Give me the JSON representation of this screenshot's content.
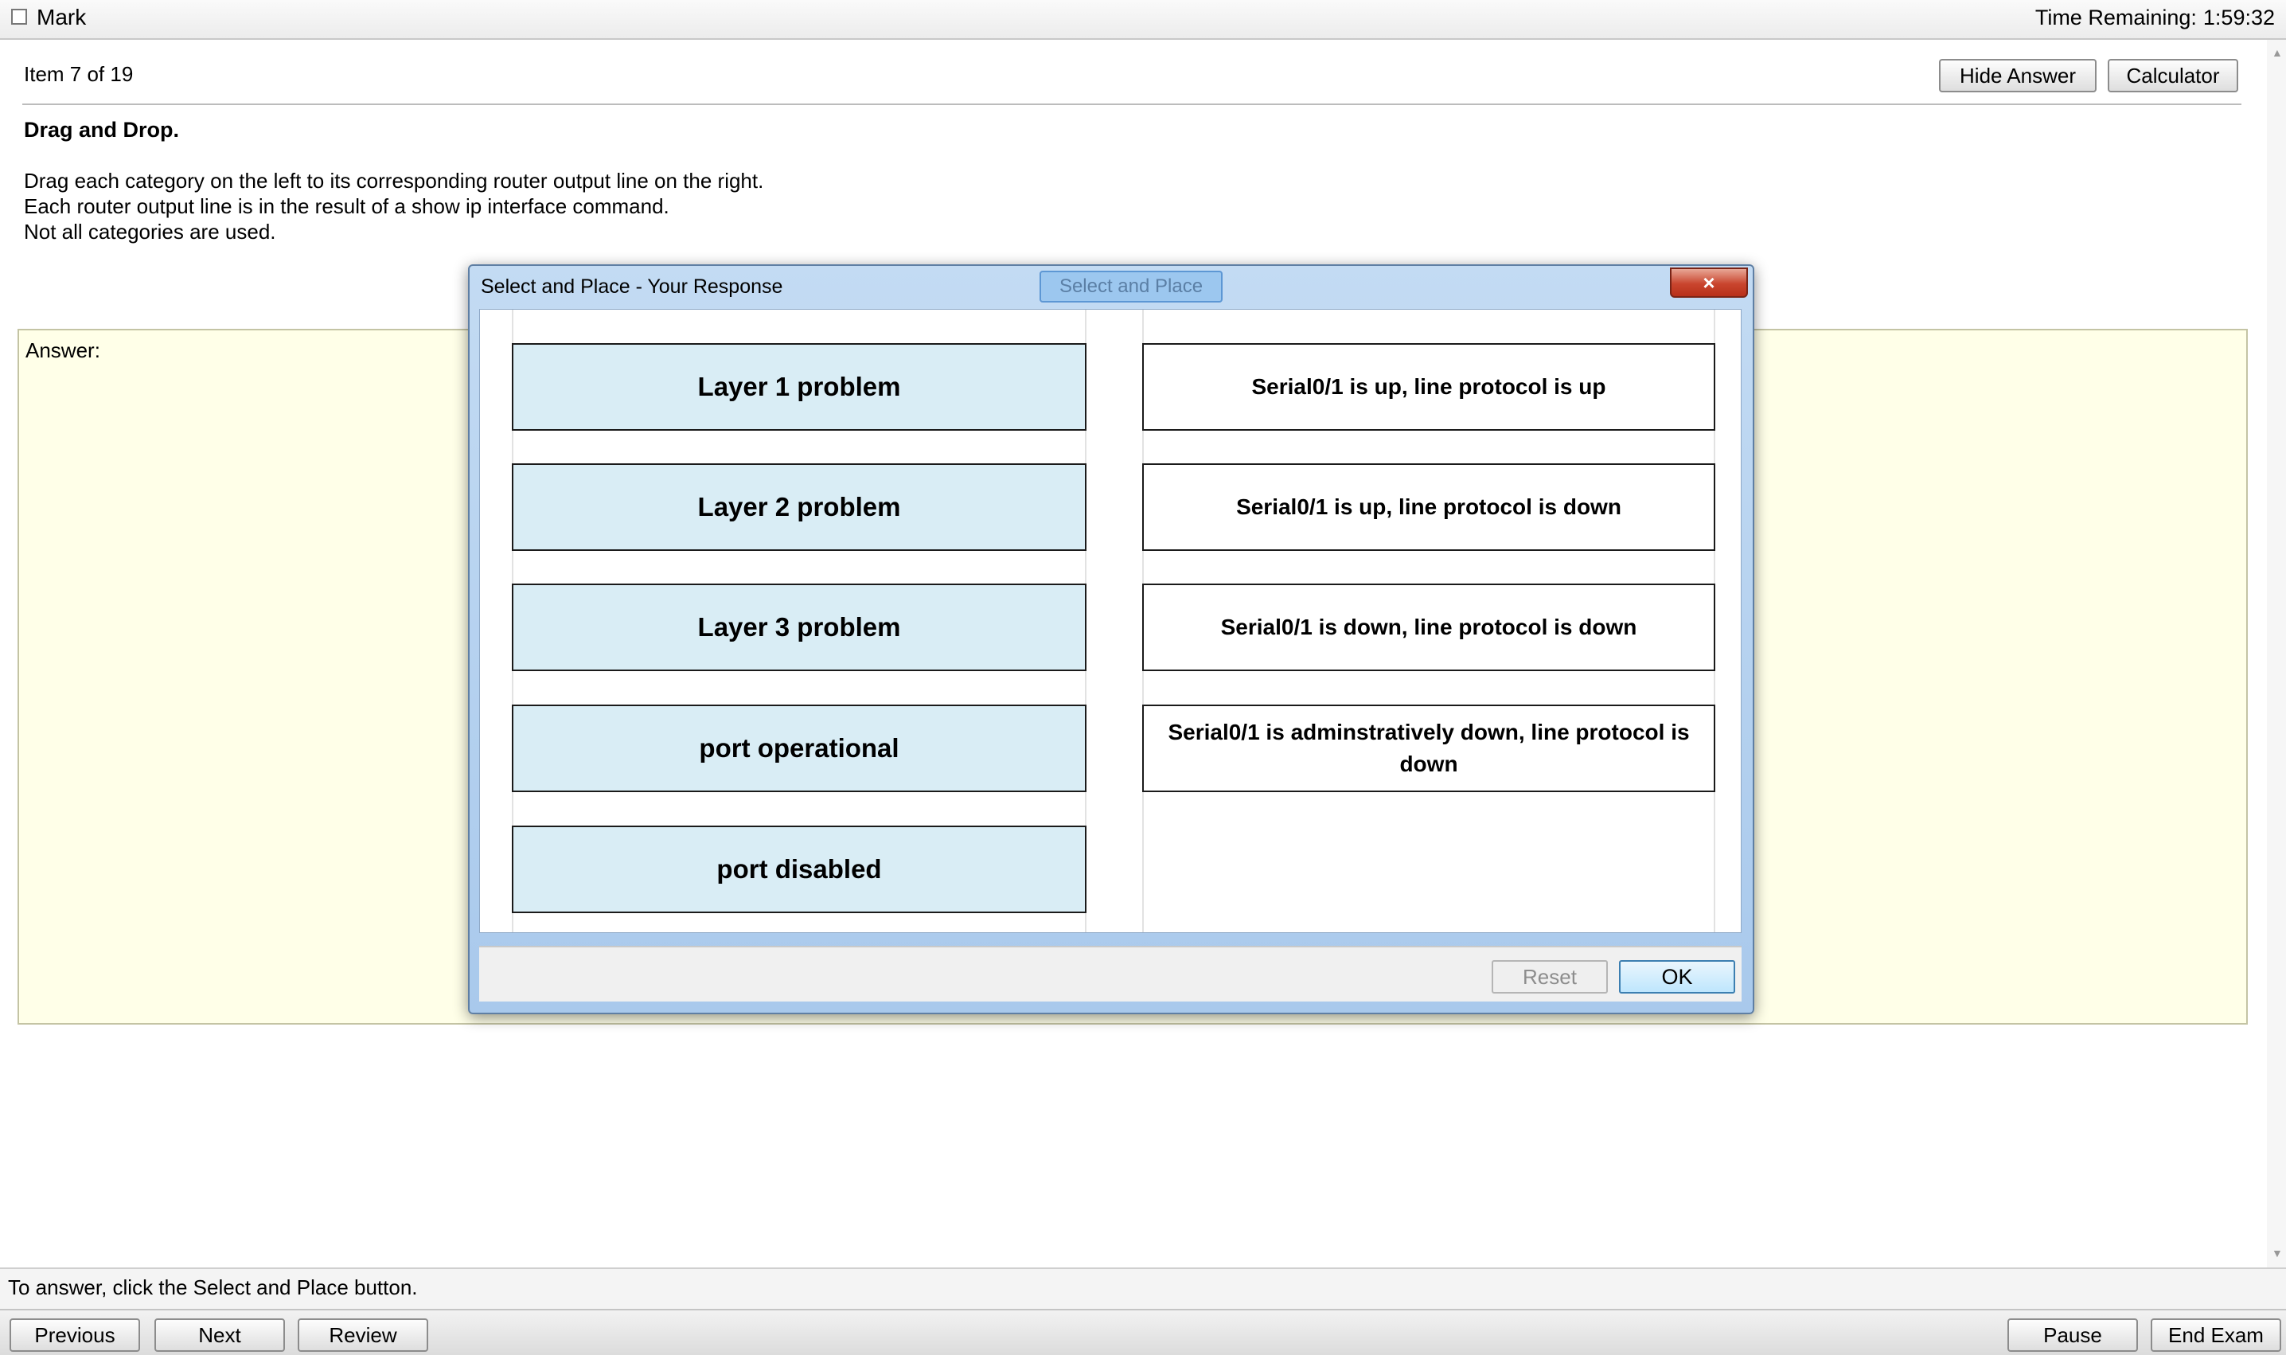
{
  "topbar": {
    "mark_label": "Mark",
    "time_label": "Time Remaining:",
    "time_value": "1:59:32"
  },
  "header": {
    "item_counter": "Item 7 of 19",
    "hide_answer": "Hide Answer",
    "calculator": "Calculator"
  },
  "question": {
    "title": "Drag and Drop.",
    "lines": [
      "Drag each category on the left to its corresponding router output line on the right.",
      "Each router output line is in the result of a show ip interface command.",
      "Not all categories are used."
    ]
  },
  "answer": {
    "label": "Answer:"
  },
  "dialog": {
    "title": "Select and Place - Your Response",
    "tab": "Select and Place",
    "close": "×",
    "sources": [
      "Layer 1 problem",
      "Layer 2 problem",
      "Layer 3 problem",
      "port operational",
      "port disabled"
    ],
    "targets": [
      "Serial0/1 is up, line protocol is up",
      "Serial0/1 is up, line protocol is down",
      "Serial0/1 is down, line protocol is down",
      "Serial0/1 is adminstratively down, line protocol is down"
    ],
    "reset": "Reset",
    "ok": "OK"
  },
  "footer": {
    "instruction": "To answer, click the Select and Place button.",
    "previous": "Previous",
    "next": "Next",
    "review": "Review",
    "pause": "Pause",
    "end_exam": "End Exam"
  }
}
